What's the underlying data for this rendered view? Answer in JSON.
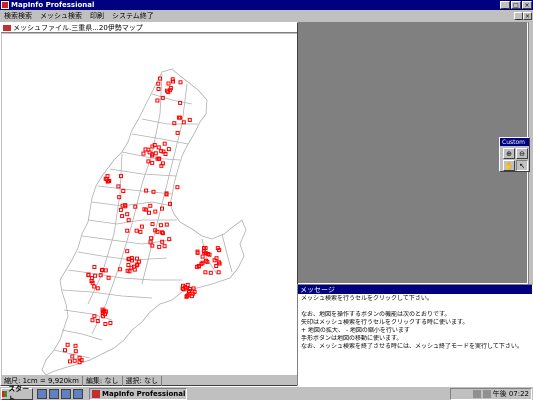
{
  "app": {
    "title": "MapInfo Professional",
    "title_controls": [
      "_",
      "□",
      "×"
    ],
    "mdi_controls": [
      "_",
      "×"
    ]
  },
  "menu": [
    "検索検索",
    "メッシュ検索",
    "印刷",
    "システム終了"
  ],
  "map_window": {
    "title": "メッシュファイル.三重県...20伊勢マップ",
    "status": {
      "scale": "縮尺: 1cm = 9,920km",
      "edit": "編集: なし",
      "select": "選択: なし"
    },
    "colors": {
      "boundary": "#b0b0b0",
      "marker": "#ff0000"
    }
  },
  "custom_palette": {
    "title": "Custom",
    "tools": [
      {
        "icon": "zoom-in-icon",
        "glyph": "⊕"
      },
      {
        "icon": "zoom-out-icon",
        "glyph": "⊖"
      },
      {
        "icon": "hand-icon",
        "glyph": "✋"
      },
      {
        "icon": "arrow-icon",
        "glyph": "↖"
      }
    ]
  },
  "message_window": {
    "title": "メッセージ",
    "lines": [
      "メッシュ検索を行うセルをクリックして下さい。",
      "",
      "なお、地図を操作するボタンの機能は次のとおりです。",
      "矢印はメッシュ検索を行うセルをクリックする時に使います。",
      "+   地図の拡大、 -   地図の縮小を行います",
      "手形ボタンは地図の移動に使います。",
      "なお、メッシュ検索を終了させる時には、メッシュ終了モードを実行して下さい。"
    ]
  },
  "taskbar": {
    "start_label": "スタート",
    "task_label": "MapInfo Professional",
    "clock": "午後 07:22"
  }
}
